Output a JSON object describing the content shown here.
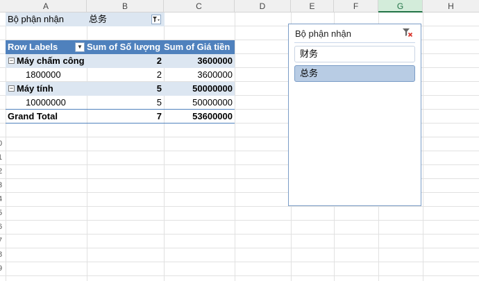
{
  "columns": [
    "A",
    "B",
    "C",
    "D",
    "E",
    "F",
    "G",
    "H"
  ],
  "selected_column": "G",
  "row_numbers": [
    "0",
    "1",
    "2",
    "3",
    "4",
    "5",
    "6",
    "7",
    "8",
    "9"
  ],
  "report_filter": {
    "label": "Bộ phận nhận",
    "value": "总务",
    "dropdown_icon": "filter-dropdown-icon"
  },
  "pivot": {
    "headers": {
      "row_labels": "Row Labels",
      "sum_qty": "Sum of Số lượng",
      "sum_price": "Sum of Giá tiền"
    },
    "groups": [
      {
        "label": "Máy chấm công",
        "qty": "2",
        "price": "3600000",
        "children": [
          {
            "label": "1800000",
            "qty": "2",
            "price": "3600000"
          }
        ]
      },
      {
        "label": "Máy tính",
        "qty": "5",
        "price": "50000000",
        "children": [
          {
            "label": "10000000",
            "qty": "5",
            "price": "50000000"
          }
        ]
      }
    ],
    "grand_total": {
      "label": "Grand Total",
      "qty": "7",
      "price": "53600000"
    }
  },
  "slicer": {
    "title": "Bộ phận nhận",
    "clear_icon": "clear-filter-icon",
    "items": [
      {
        "label": "财务",
        "selected": false
      },
      {
        "label": "总务",
        "selected": true
      }
    ]
  },
  "colors": {
    "header_blue": "#4f81bd",
    "band_blue": "#dce6f1",
    "selected_item": "#b8cce4",
    "selected_column": "#217346"
  }
}
